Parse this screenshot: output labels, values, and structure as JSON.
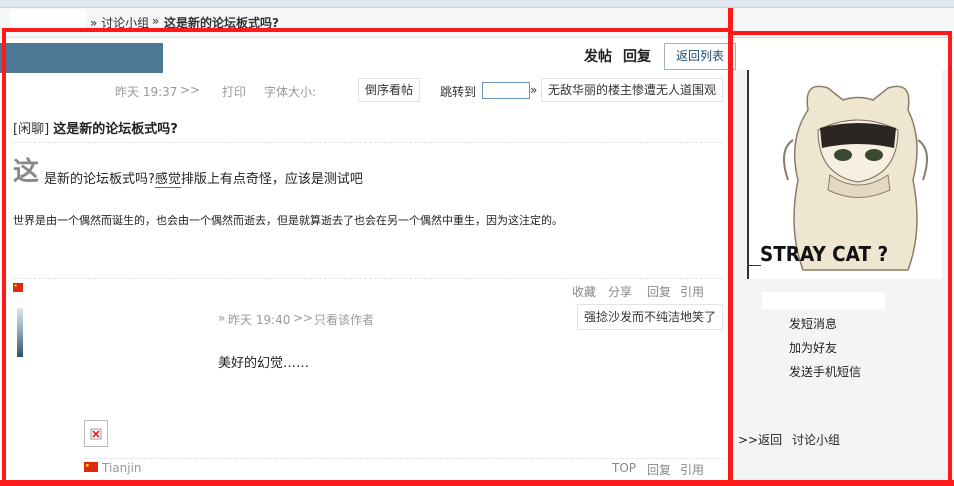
{
  "breadcrumb": {
    "sep1": "»",
    "level1": "讨论小组",
    "sep2": "»",
    "current": "这是新的论坛板式吗?"
  },
  "toolbar": {
    "post_label": "发帖",
    "reply_label": "回复",
    "back_list_label": "返回列表"
  },
  "post1": {
    "time": "昨天 19:37",
    "arrow": ">>",
    "print": "打印",
    "font_size": "字体大小:",
    "reverse_label": "倒序看帖",
    "jump_label": "跳转到",
    "jump_arrow": "»",
    "prev_thread": "无敌华丽的楼主惨遭无人道围观",
    "tag": "[闲聊]",
    "title": "这是新的论坛板式吗?",
    "dropcap": "这",
    "line1_a": "是新的论坛板式吗?",
    "line1_b": "感觉",
    "line1_c": "排版上有点奇怪，应该是测试吧",
    "line2": "世界是由一个偶然而诞生的，也会由一个偶然而逝去，但是就算逝去了也会在另一个偶然中重生，因为这注定的。",
    "actions": [
      "收藏",
      "分享",
      "回复",
      "引用"
    ]
  },
  "post2": {
    "dot": "»",
    "time": "昨天 19:40",
    "arrow": ">>",
    "only_author": "只看该作者",
    "next_thread": "强捻沙发而不纯洁地笑了",
    "body": "美好的幻觉……",
    "location": "Tianjin",
    "actions": [
      "TOP",
      "回复",
      "引用"
    ]
  },
  "sidebar": {
    "image_caption": "STRAY CAT ?",
    "links": [
      "发短消息",
      "加为好友",
      "发送手机短信"
    ],
    "back_prefix": ">>返回",
    "back_target": "讨论小组"
  },
  "colors": {
    "accent_blue": "#4f7796",
    "annotation_red": "#ff1a1a",
    "link_blue": "#1b4a75"
  }
}
